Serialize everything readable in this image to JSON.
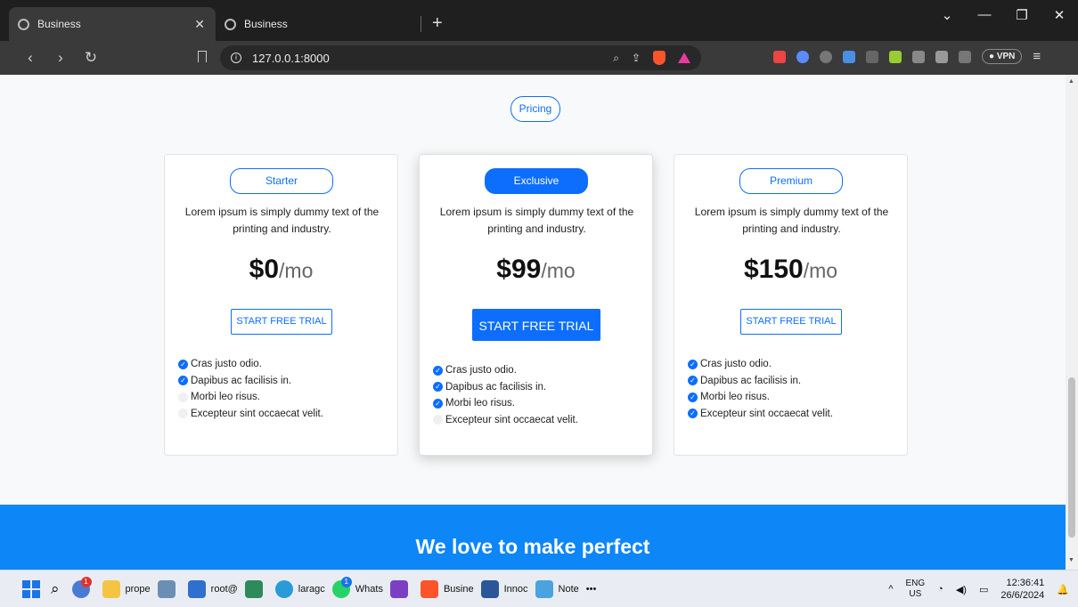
{
  "browser": {
    "tabs": [
      {
        "title": "Business",
        "active": true
      },
      {
        "title": "Business",
        "active": false
      }
    ],
    "url": "127.0.0.1:8000",
    "vpn_label": "VPN"
  },
  "page": {
    "section_pill": "Pricing",
    "plans": [
      {
        "name": "Starter",
        "description": "Lorem ipsum is simply dummy text of the printing and industry.",
        "price": "$0",
        "period": "/mo",
        "cta": "START FREE TRIAL",
        "features": [
          {
            "text": "Cras justo odio.",
            "included": true
          },
          {
            "text": "Dapibus ac facilisis in.",
            "included": true
          },
          {
            "text": "Morbi leo risus.",
            "included": false
          },
          {
            "text": "Excepteur sint occaecat velit.",
            "included": false
          }
        ]
      },
      {
        "name": "Exclusive",
        "description": "Lorem ipsum is simply dummy text of the printing and industry.",
        "price": "$99",
        "period": "/mo",
        "cta": "START FREE TRIAL",
        "features": [
          {
            "text": "Cras justo odio.",
            "included": true
          },
          {
            "text": "Dapibus ac facilisis in.",
            "included": true
          },
          {
            "text": "Morbi leo risus.",
            "included": true
          },
          {
            "text": "Excepteur sint occaecat velit.",
            "included": false
          }
        ]
      },
      {
        "name": "Premium",
        "description": "Lorem ipsum is simply dummy text of the printing and industry.",
        "price": "$150",
        "period": "/mo",
        "cta": "START FREE TRIAL",
        "features": [
          {
            "text": "Cras justo odio.",
            "included": true
          },
          {
            "text": "Dapibus ac facilisis in.",
            "included": true
          },
          {
            "text": "Morbi leo risus.",
            "included": true
          },
          {
            "text": "Excepteur sint occaecat velit.",
            "included": true
          }
        ]
      }
    ],
    "banner_title": "We love to make perfect"
  },
  "taskbar": {
    "items": [
      {
        "label": "prope"
      },
      {
        "label": "root@"
      },
      {
        "label": "laragc"
      },
      {
        "label": "Whats",
        "badge": "1"
      },
      {
        "label": "Busine"
      },
      {
        "label": "Innoc"
      },
      {
        "label": "Note"
      }
    ],
    "people_badge": "1",
    "more": "•••",
    "lang_top": "ENG",
    "lang_bottom": "US",
    "time": "12:36:41",
    "date": "26/6/2024"
  },
  "colors": {
    "accent": "#0d6efd",
    "banner": "#0d86f7"
  }
}
